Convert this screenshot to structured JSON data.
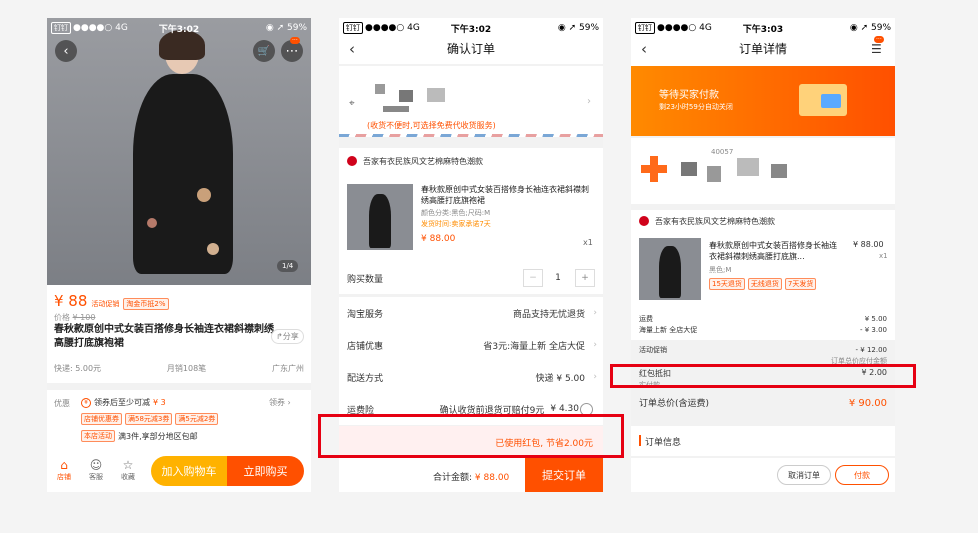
{
  "status_bar": {
    "carrier": "钉钉",
    "signal": "●●●●○",
    "network": "4G",
    "times": [
      "下午3:02",
      "下午3:02",
      "下午3:03"
    ],
    "right": "◉ ➚ 59%"
  },
  "product_page": {
    "image_index": "1/4",
    "price": "¥ 88",
    "promo_tags": [
      "活动促销",
      "淘金币抵2%"
    ],
    "orig_label": "价格",
    "orig_price": "¥ 100",
    "title": "春秋款原创中式女装百搭修身长袖连衣裙斜襟刺绣高腰打底旗袍裙",
    "share": "分享",
    "shipping": "快递: 5.00元",
    "sales": "月销108笔",
    "location": "广东广州",
    "discount_label": "优惠",
    "coupon_text": "领券后至少可减",
    "coupon_amount": "¥ 3",
    "coupon_action": "领券",
    "shop_coupon_tag": "店铺优惠券",
    "shop_coupon_1": "满58元减3券",
    "shop_coupon_2": "满5元减2券",
    "activity_tag": "本店活动",
    "activity_text": "满3件,享部分地区包邮",
    "nav_shop": "店铺",
    "nav_service": "客服",
    "nav_fav": "收藏",
    "add_cart": "加入购物车",
    "buy_now": "立即购买"
  },
  "confirm_page": {
    "title": "确认订单",
    "address_note": "(收货不便时,可选择免费代收货服务)",
    "shop_name": "吾家有衣民族风文艺棉麻特色潮款",
    "item_title": "春秋款原创中式女装百搭修身长袖连衣裙斜襟刺绣高腰打底旗袍裙",
    "item_attr": "颜色分类:黑色;尺码:M",
    "item_ship": "发货时间:卖家承诺7天",
    "item_price": "¥ 88.00",
    "item_qty": "x1",
    "qty_label": "购买数量",
    "qty_value": "1",
    "service_label": "淘宝服务",
    "service_value": "商品支持无忧退货",
    "shop_discount_label": "店铺优惠",
    "shop_discount_value": "省3元:海量上新 全店大促",
    "delivery_label": "配送方式",
    "delivery_value": "快递 ¥ 5.00",
    "insurance_label": "运费险",
    "insurance_value": "确认收货前退货可赔付9元",
    "insurance_price": "¥ 4.30",
    "redpacket_text": "已使用红包, 节省2.00元",
    "total_label": "合计金额:",
    "total_value": "¥ 88.00",
    "submit": "提交订单"
  },
  "detail_page": {
    "title": "订单详情",
    "banner_title": "等待买家付款",
    "banner_sub": "剩23小时59分自动关闭",
    "phone_partial": "40057",
    "shop_name": "吾家有衣民族风文艺棉麻特色潮款",
    "item_title": "春秋款原创中式女装百搭修身长袖连衣裙斜襟刺绣高腰打底旗...",
    "item_price": "¥ 88.00",
    "item_qty": "x1",
    "item_attr": "黑色;M",
    "tags": [
      "15天退货",
      "无线退货",
      "7天发货"
    ],
    "fees": [
      {
        "label": "运费",
        "value": "¥ 5.00"
      },
      {
        "label": "海量上新 全店大促",
        "value": "- ¥ 3.00"
      },
      {
        "label": "活动促销",
        "value": "- ¥ 12.00"
      }
    ],
    "paid_note": "订单总价应付金额",
    "redpacket_label": "红包抵扣",
    "redpacket_value": "¥ 2.00",
    "actual_label": "实付款",
    "total_label": "订单总价(含运费)",
    "total_value": "¥ 90.00",
    "order_info": "订单信息",
    "cancel": "取消订单",
    "pay": "付款"
  },
  "colors": {
    "accent": "#ff5000",
    "highlight": "#e60012",
    "cart_button": "#ffb200"
  }
}
